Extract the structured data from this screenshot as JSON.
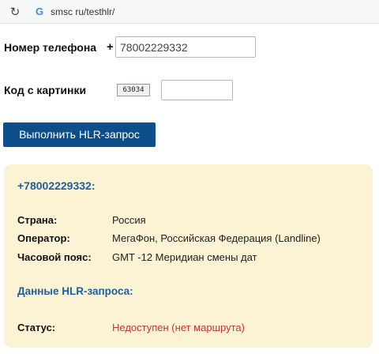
{
  "browser": {
    "url": "smsc ru/testhlr/"
  },
  "form": {
    "phone_label": "Номер телефона",
    "plus": "+",
    "phone_value": "78002229332",
    "captcha_label": "Код с картинки",
    "captcha_image_text": "63034",
    "captcha_value": "",
    "submit_label": "Выполнить HLR-запрос"
  },
  "result": {
    "number_heading": "+78002229332:",
    "country_label": "Страна:",
    "country_value": "Россия",
    "operator_label": "Оператор:",
    "operator_value": "МегаФон, Российская Федерация (Landline)",
    "timezone_label": "Часовой пояс:",
    "timezone_value": "GMT -12 Меридиан смены дат",
    "hlr_heading": "Данные HLR-запроса:",
    "status_label": "Статус:",
    "status_value": "Недоступен (нет маршрута)"
  },
  "colors": {
    "button_bg": "#0d4f8b",
    "panel_bg": "#fbf3d3",
    "heading_blue": "#1f5fa0",
    "status_red": "#c0392b"
  },
  "icons": {
    "reload": "reload-icon",
    "site": "google-g-icon"
  }
}
